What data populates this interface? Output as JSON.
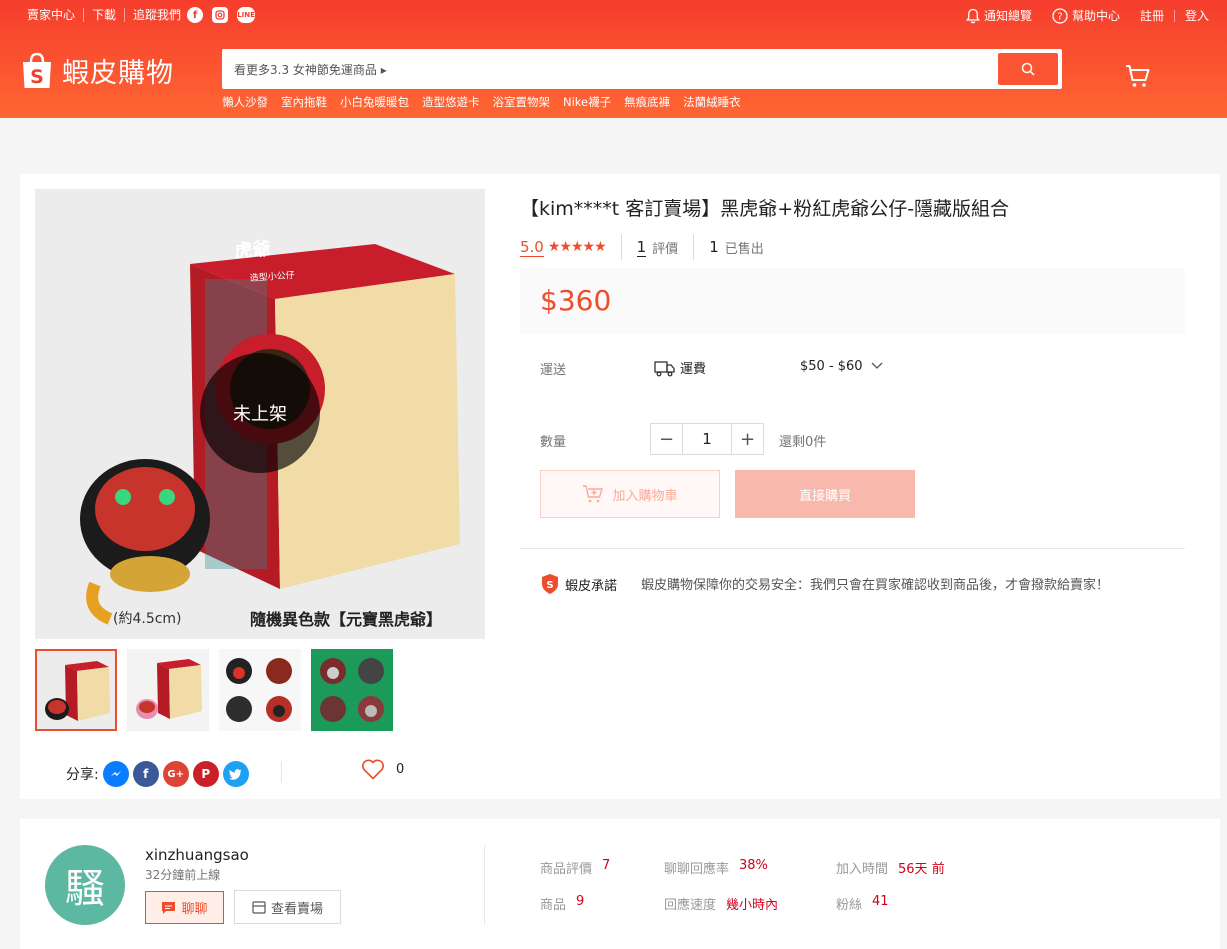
{
  "topbar": {
    "seller_center": "賣家中心",
    "download": "下載",
    "follow_us": "追蹤我們",
    "notifications": "通知總覽",
    "help": "幫助中心",
    "register": "註冊",
    "login": "登入"
  },
  "logo": {
    "name": "蝦皮購物",
    "bag_letter": "S"
  },
  "search": {
    "placeholder": "看更多3.3 女神節免運商品 ▸",
    "hot_keywords": [
      "懶人沙發",
      "室內拖鞋",
      "小白兔暖暖包",
      "造型悠遊卡",
      "浴室置物架",
      "Nike襪子",
      "無痕底褲",
      "法蘭絨睡衣"
    ]
  },
  "product": {
    "title": "【kim****t 客訂賣場】黑虎爺+粉紅虎爺公仔-隱藏版組合",
    "rating": "5.0",
    "stars": "★★★★★",
    "review_count": "1",
    "review_label": "評價",
    "sold_count": "1",
    "sold_label": "已售出",
    "price": "$360",
    "unavailable_label": "未上架",
    "image_caption_size": "(約4.5cm)",
    "image_caption_title": "隨機異色款【元寶黑虎爺】",
    "box_brand": "虎爺",
    "box_subtitle": "造型小公仔",
    "shipping_label": "運送",
    "shipping_fee_label": "運費",
    "shipping_fee": "$50 - $60",
    "quantity_label": "數量",
    "quantity": "1",
    "minus": "−",
    "plus": "+",
    "stock": "還剩0件",
    "add_to_cart": "加入購物車",
    "buy_now": "直接購買",
    "promise_name": "蝦皮承諾",
    "promise_text": "蝦皮購物保障你的交易安全：我們只會在買家確認收到商品後，才會撥款給賣家！",
    "share_label": "分享:",
    "likes": "0"
  },
  "shop": {
    "avatar_char": "騷",
    "name": "xinzhuangsao",
    "online": "32分鐘前上線",
    "chat": "聊聊",
    "view_shop": "查看賣場",
    "stats": {
      "ratings_label": "商品評價",
      "ratings": "7",
      "response_rate_label": "聊聊回應率",
      "response_rate": "38%",
      "joined_label": "加入時間",
      "joined": "56天 前",
      "products_label": "商品",
      "products": "9",
      "response_time_label": "回應速度",
      "response_time": "幾小時內",
      "followers_label": "粉絲",
      "followers": "41"
    }
  },
  "colors": {
    "brand": "#ee4d2d",
    "header_top": "#f53d2d",
    "header_bottom": "#ff6633"
  }
}
